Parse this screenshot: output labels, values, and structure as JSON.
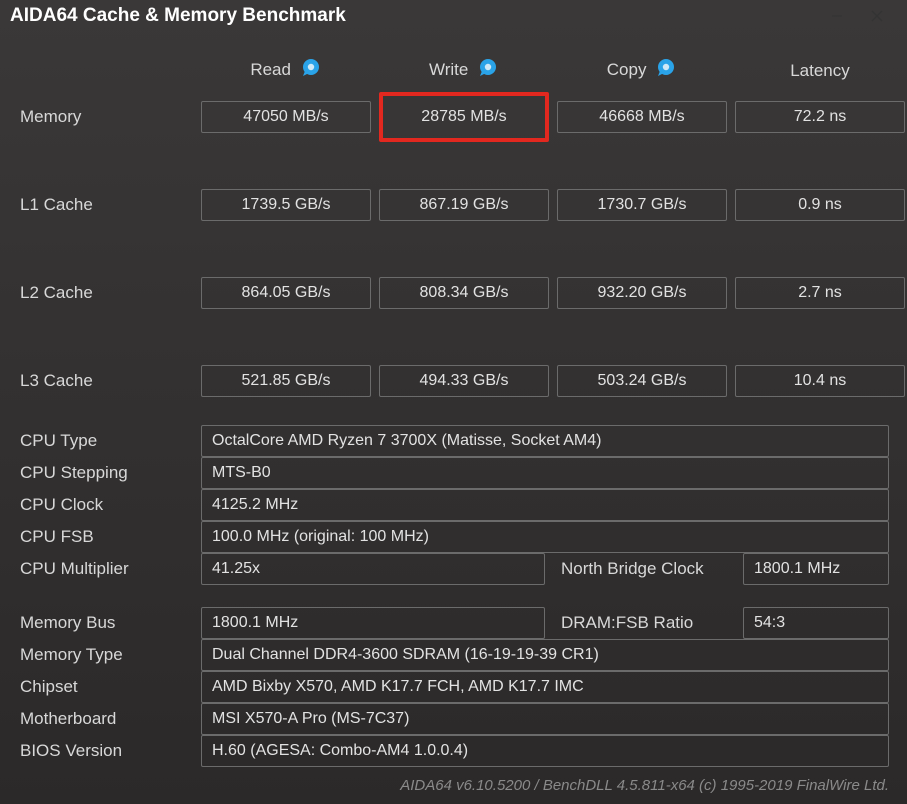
{
  "window": {
    "title": "AIDA64 Cache & Memory Benchmark"
  },
  "headers": {
    "read": "Read",
    "write": "Write",
    "copy": "Copy",
    "latency": "Latency"
  },
  "rows": {
    "memory": {
      "label": "Memory",
      "read": "47050 MB/s",
      "write": "28785 MB/s",
      "copy": "46668 MB/s",
      "latency": "72.2 ns"
    },
    "l1": {
      "label": "L1 Cache",
      "read": "1739.5 GB/s",
      "write": "867.19 GB/s",
      "copy": "1730.7 GB/s",
      "latency": "0.9 ns"
    },
    "l2": {
      "label": "L2 Cache",
      "read": "864.05 GB/s",
      "write": "808.34 GB/s",
      "copy": "932.20 GB/s",
      "latency": "2.7 ns"
    },
    "l3": {
      "label": "L3 Cache",
      "read": "521.85 GB/s",
      "write": "494.33 GB/s",
      "copy": "503.24 GB/s",
      "latency": "10.4 ns"
    }
  },
  "info": {
    "cpu_type": {
      "label": "CPU Type",
      "value": "OctalCore AMD Ryzen 7 3700X  (Matisse, Socket AM4)"
    },
    "cpu_stepping": {
      "label": "CPU Stepping",
      "value": "MTS-B0"
    },
    "cpu_clock": {
      "label": "CPU Clock",
      "value": "4125.2 MHz"
    },
    "cpu_fsb": {
      "label": "CPU FSB",
      "value": "100.0 MHz  (original: 100 MHz)"
    },
    "cpu_multiplier": {
      "label": "CPU Multiplier",
      "value": "41.25x",
      "label2": "North Bridge Clock",
      "value2": "1800.1 MHz"
    },
    "memory_bus": {
      "label": "Memory Bus",
      "value": "1800.1 MHz",
      "label2": "DRAM:FSB Ratio",
      "value2": "54:3"
    },
    "memory_type": {
      "label": "Memory Type",
      "value": "Dual Channel DDR4-3600 SDRAM  (16-19-19-39 CR1)"
    },
    "chipset": {
      "label": "Chipset",
      "value": "AMD Bixby X570, AMD K17.7 FCH, AMD K17.7 IMC"
    },
    "motherboard": {
      "label": "Motherboard",
      "value": "MSI X570-A Pro (MS-7C37)"
    },
    "bios": {
      "label": "BIOS Version",
      "value": "H.60  (AGESA: Combo-AM4 1.0.0.4)"
    }
  },
  "footer": "AIDA64 v6.10.5200 / BenchDLL 4.5.811-x64  (c) 1995-2019 FinalWire Ltd."
}
